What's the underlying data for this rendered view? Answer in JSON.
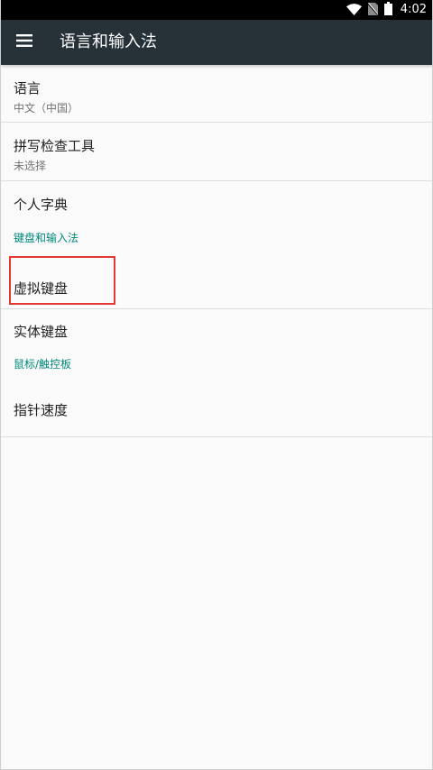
{
  "status_bar": {
    "time": "4:02",
    "icons": [
      "wifi-icon",
      "no-sim-icon",
      "battery-icon"
    ]
  },
  "app_bar": {
    "menu_icon": "hamburger-menu-icon",
    "title": "语言和输入法"
  },
  "items": {
    "language": {
      "title": "语言",
      "subtitle": "中文（中国）"
    },
    "spell_checker": {
      "title": "拼写检查工具",
      "subtitle": "未选择"
    },
    "personal_dictionary": {
      "title": "个人字典"
    },
    "keyboard_category": "键盘和输入法",
    "virtual_keyboard": {
      "title": "虚拟键盘"
    },
    "physical_keyboard": {
      "title": "实体键盘"
    },
    "mouse_category": "鼠标/触控板",
    "pointer_speed": {
      "title": "指针速度"
    }
  },
  "colors": {
    "app_bar": "#263238",
    "category_accent": "#00897b",
    "highlight": "#e53935"
  }
}
